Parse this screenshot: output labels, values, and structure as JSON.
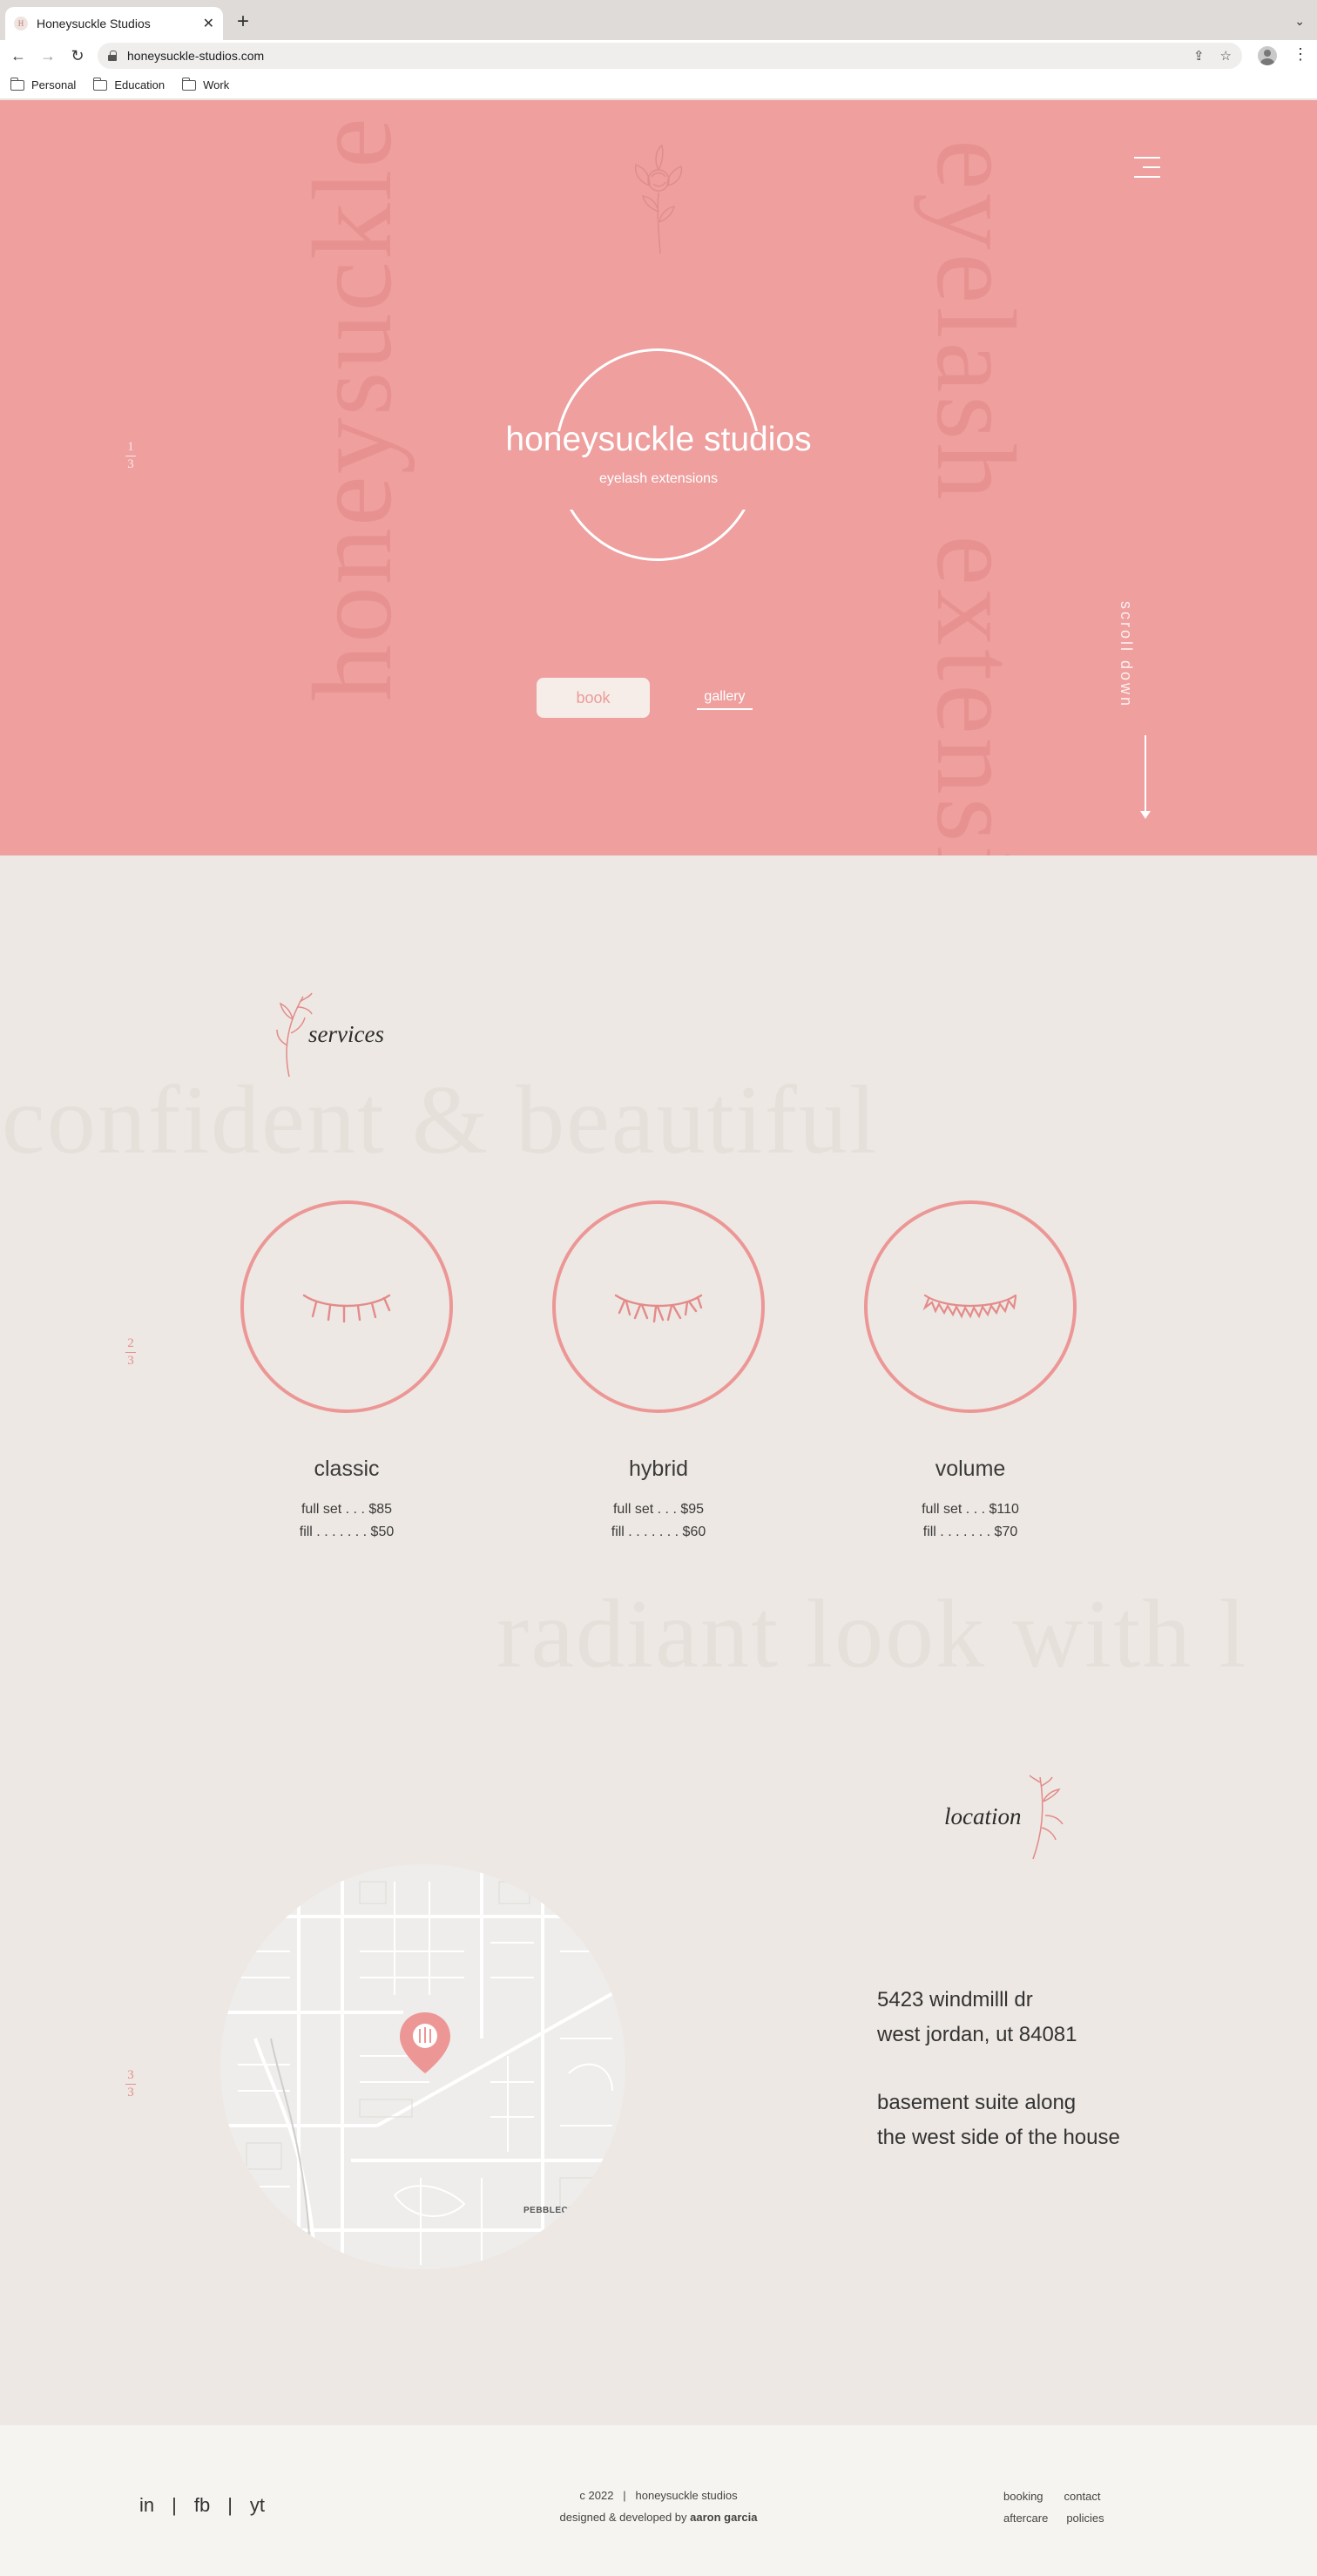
{
  "browser": {
    "tab_title": "Honeysuckle Studios",
    "tab_favicon": "H",
    "new_tab": "+",
    "url": "honeysuckle-studios.com",
    "bookmarks": [
      "Personal",
      "Education",
      "Work"
    ]
  },
  "hero": {
    "vertical_left": "honeysuckle s",
    "vertical_right": "eyelash extension",
    "page_indicator": {
      "current": "1",
      "total": "3"
    },
    "title": "honeysuckle studios",
    "subtitle": "eyelash extensions",
    "book_label": "book",
    "gallery_label": "gallery",
    "scroll_label": "scroll down"
  },
  "services": {
    "heading": "services",
    "bg_phrase_1": "confident & beautiful",
    "bg_phrase_2": "radiant look with l",
    "page_indicator": {
      "current": "2",
      "total": "3"
    },
    "items": [
      {
        "name": "classic",
        "full_set": "full set . . . $85",
        "fill": "fill . . . . . . . $50"
      },
      {
        "name": "hybrid",
        "full_set": "full set . . . $95",
        "fill": "fill . . . . . . . $60"
      },
      {
        "name": "volume",
        "full_set": "full set . . . $110",
        "fill": "fill . . . . . . . $70"
      }
    ]
  },
  "location": {
    "heading": "location",
    "page_indicator": {
      "current": "3",
      "total": "3"
    },
    "map_label": "PEBBLECR",
    "address_line1": "5423 windmilll dr",
    "address_line2": "west jordan, ut 84081",
    "note_line1": "basement suite along",
    "note_line2": "the west side of the house"
  },
  "footer": {
    "social": [
      "in",
      "fb",
      "yt"
    ],
    "social_sep": "|",
    "copyright": "c 2022   |   honeysuckle studios",
    "credit_prefix": "designed & developed by ",
    "credit_name": "aaron garcia",
    "links": [
      "booking",
      "contact",
      "aftercare",
      "policies"
    ]
  },
  "colors": {
    "accent_pink": "#ee9f9e",
    "line_pink": "#ec9796",
    "background": "#ede8e3",
    "footer_bg": "#f5f4f0"
  }
}
